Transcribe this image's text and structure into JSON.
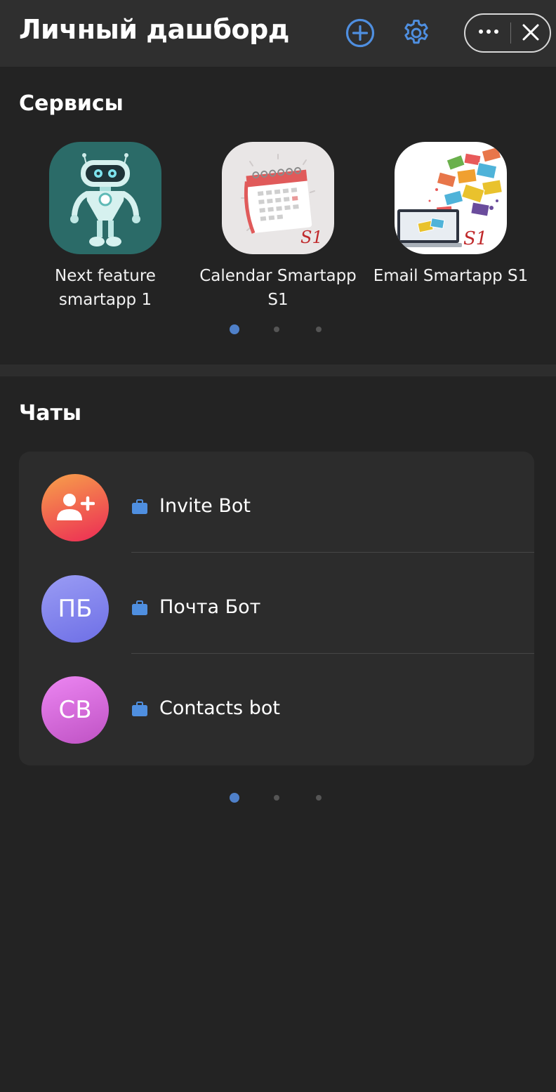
{
  "header": {
    "title": "Личный дашборд",
    "accent_color": "#4f8fe0",
    "add_icon": "plus-circle-icon",
    "settings_icon": "gear-icon",
    "more_icon": "more-dots-icon",
    "close_icon": "close-icon"
  },
  "services": {
    "title": "Сервисы",
    "items": [
      {
        "label_line1": "Next feature",
        "label_line2": "smartapp 1",
        "icon": "robot-icon",
        "bg": "#2b6b68"
      },
      {
        "label_line1": "Calendar Smartapp",
        "label_line2": "S1",
        "icon": "calendar-icon",
        "bg": "#e9e6e6"
      },
      {
        "label_line1": "Email Smartapp S1",
        "label_line2": "",
        "icon": "email-envelopes-icon",
        "bg": "#ffffff"
      }
    ],
    "pager": {
      "pages": 3,
      "active": 1
    }
  },
  "chats": {
    "title": "Чаты",
    "items": [
      {
        "name": "Invite Bot",
        "avatar_text": "",
        "avatar_icon": "add-user-icon",
        "avatar_gradient": [
          "#f7a24a",
          "#ec2a55"
        ],
        "badge_icon": "briefcase-icon"
      },
      {
        "name": "Почта Бот",
        "avatar_text": "ПБ",
        "avatar_gradient": [
          "#9a9cf4",
          "#6e6fe6"
        ],
        "badge_icon": "briefcase-icon"
      },
      {
        "name": "Contacts bot",
        "avatar_text": "CB",
        "avatar_gradient": [
          "#ec86f2",
          "#bf52c4"
        ],
        "badge_icon": "briefcase-icon"
      }
    ],
    "pager": {
      "pages": 3,
      "active": 1
    }
  }
}
